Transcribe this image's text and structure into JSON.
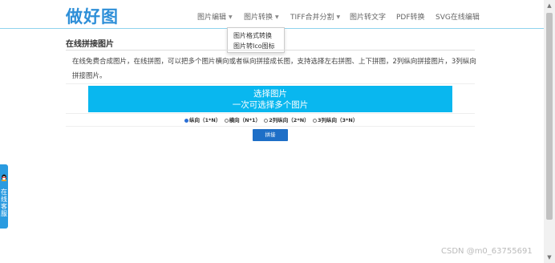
{
  "header": {
    "logo": "做好图",
    "nav": [
      {
        "label": "图片编辑",
        "has_caret": true
      },
      {
        "label": "图片转换",
        "has_caret": true
      },
      {
        "label": "TIFF合并分割",
        "has_caret": true
      },
      {
        "label": "图片转文字",
        "has_caret": false
      },
      {
        "label": "PDF转换",
        "has_caret": false
      },
      {
        "label": "SVG在线编辑",
        "has_caret": false
      }
    ],
    "dropdown": [
      "图片格式转换",
      "图片转Ico图标"
    ]
  },
  "main": {
    "title": "在线拼接图片",
    "intro": "在线免费合成图片，在线拼图，可以把多个图片横向或者纵向拼接成长图，支持选择左右拼图、上下拼图，2列纵向拼接图片，3列纵向拼接图片。",
    "select_button": {
      "line1": "选择图片",
      "line2": "一次可选择多个图片"
    },
    "options": [
      {
        "label": "纵向（1*N）",
        "checked": true
      },
      {
        "label": "横向（N*1）",
        "checked": false
      },
      {
        "label": "2列纵向（2*N）",
        "checked": false
      },
      {
        "label": "3列纵向（3*N）",
        "checked": false
      }
    ],
    "join_button": "拼接"
  },
  "side_service": "在线客服",
  "watermark": "CSDN @m0_63755691",
  "colors": {
    "accent": "#09b7ef",
    "logo": "#2e8fd8",
    "button": "#1e6fc7"
  }
}
